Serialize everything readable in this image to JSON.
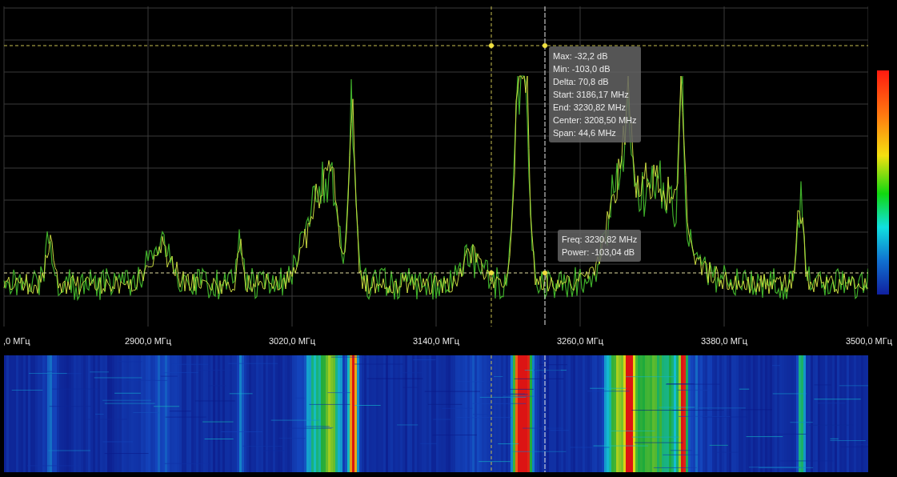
{
  "measurement_tooltip": {
    "lines": [
      "Max: -32,2 dB",
      "Min: -103,0 dB",
      "Delta: 70,8 dB",
      "Start: 3186,17 MHz",
      "End: 3230,82 MHz",
      "Center: 3208,50 MHz",
      "Span: 44,6 MHz"
    ]
  },
  "cursor_tooltip": {
    "lines": [
      "Freq: 3230,82 MHz",
      "Power: -103,04 dB"
    ]
  },
  "x_axis": {
    "labels": [
      ",0 МГц",
      "2900,0 МГц",
      "3020,0 МГц",
      "3140,0 МГц",
      "3260,0 МГц",
      "3380,0 МГц",
      "3500,0 МГц"
    ]
  }
}
